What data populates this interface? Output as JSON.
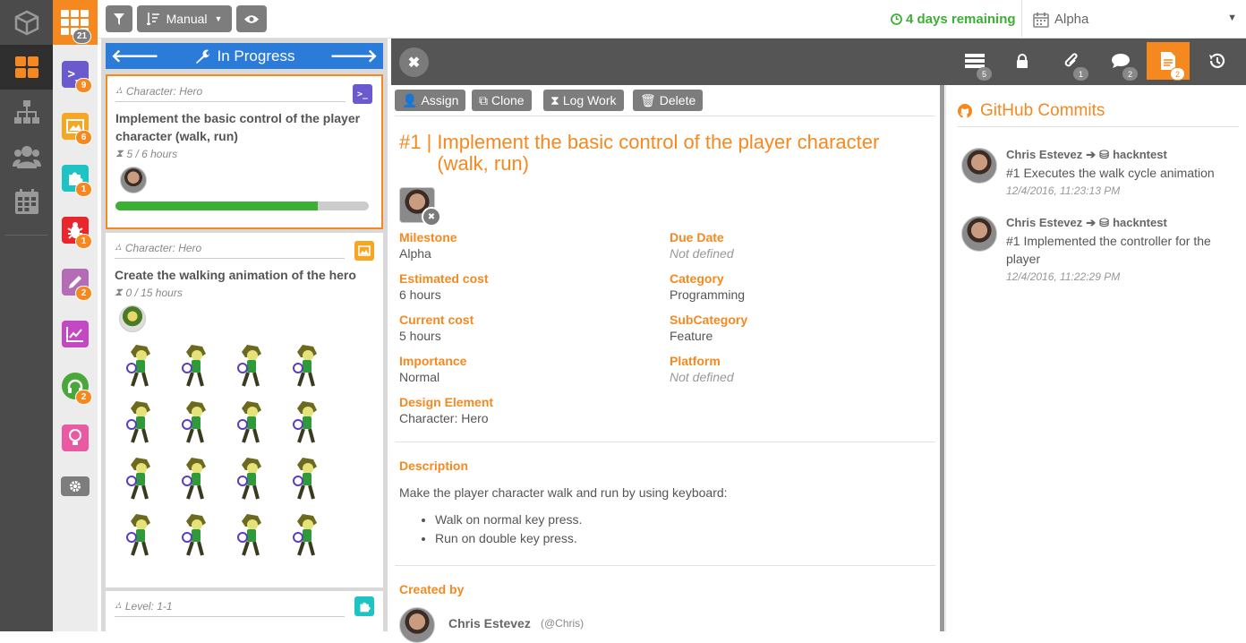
{
  "rail": {
    "items": [
      "cube-icon",
      "board-icon",
      "hierarchy-icon",
      "users-icon",
      "calendar-icon"
    ]
  },
  "categories": [
    {
      "name": "tasks-category",
      "count": "21",
      "color": "#f5891f"
    },
    {
      "name": "console-category",
      "count": "9",
      "color": "#6a5acd"
    },
    {
      "name": "image-category",
      "count": "6",
      "color": "#f5a623"
    },
    {
      "name": "puzzle-category",
      "count": "1",
      "color": "#1ec4c4"
    },
    {
      "name": "bug-category",
      "count": "1",
      "color": "#e8262c"
    },
    {
      "name": "pencil-category",
      "count": "2",
      "color": "#b46cb6"
    },
    {
      "name": "chart-category",
      "count": "",
      "color": "#c447c4"
    },
    {
      "name": "sound-category",
      "count": "2",
      "color": "#4aa83a"
    },
    {
      "name": "idea-category",
      "count": "",
      "color": "#ea5aa3"
    }
  ],
  "toolbar": {
    "sort_label": "Manual",
    "remaining": "4 days remaining",
    "milestone": "Alpha"
  },
  "column": {
    "title": "In Progress",
    "cards": [
      {
        "category": "Character: Hero",
        "title": "Implement the basic control of the player character (walk, run)",
        "hours": "5 / 6 hours",
        "progress": 0.8
      },
      {
        "category": "Character: Hero",
        "title": "Create the walking animation of the hero",
        "hours": "0 / 15 hours"
      },
      {
        "category": "Level: 1-1"
      }
    ]
  },
  "detail": {
    "tabs": [
      {
        "name": "tasks-tab-icon",
        "count": "5"
      },
      {
        "name": "lock-tab-icon",
        "count": ""
      },
      {
        "name": "attachment-tab-icon",
        "count": "1"
      },
      {
        "name": "comments-tab-icon",
        "count": "2"
      },
      {
        "name": "document-tab-icon",
        "count": "2"
      },
      {
        "name": "history-tab-icon",
        "count": ""
      }
    ],
    "actions": {
      "assign": "Assign",
      "clone": "Clone",
      "logwork": "Log Work",
      "delete": "Delete"
    },
    "title_prefix": "#1 |",
    "title": "Implement the basic control of the player character (walk, run)",
    "fields": {
      "milestone_label": "Milestone",
      "milestone": "Alpha",
      "duedate_label": "Due Date",
      "duedate": "Not defined",
      "estcost_label": "Estimated cost",
      "estcost": "6 hours",
      "category_label": "Category",
      "category": "Programming",
      "curcost_label": "Current cost",
      "curcost": "5 hours",
      "subcat_label": "SubCategory",
      "subcat": "Feature",
      "importance_label": "Importance",
      "importance": "Normal",
      "platform_label": "Platform",
      "platform": "Not defined",
      "design_label": "Design Element",
      "design": "Character: Hero"
    },
    "description_label": "Description",
    "description": "Make the player character walk and run by using keyboard:",
    "bullets": [
      "Walk on normal key press.",
      "Run on double key press."
    ],
    "createdby_label": "Created by",
    "creator": "Chris Estevez",
    "creator_handle": "(@Chris)"
  },
  "github": {
    "title": "GitHub Commits",
    "commits": [
      {
        "author": "Chris Estevez",
        "repo": "hackntest",
        "message": "#1 Executes the walk cycle animation",
        "time": "12/4/2016, 11:23:13 PM"
      },
      {
        "author": "Chris Estevez",
        "repo": "hackntest",
        "message": "#1 Implemented the controller for the player",
        "time": "12/4/2016, 11:22:29 PM"
      }
    ]
  }
}
